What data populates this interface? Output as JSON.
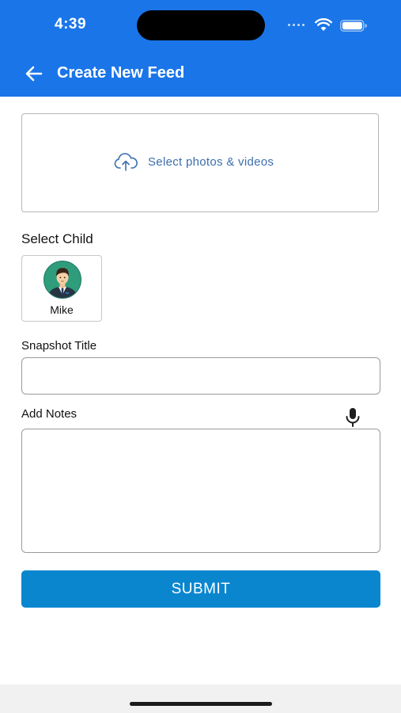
{
  "status_bar": {
    "time": "4:39"
  },
  "header": {
    "title": "Create New Feed",
    "background": "#1a75e8",
    "back_icon": "arrow-left-icon"
  },
  "upload": {
    "label": "Select photos & videos",
    "icon": "cloud-upload-icon"
  },
  "child_section": {
    "label": "Select Child",
    "children": [
      {
        "name": "Mike",
        "avatar": "boy-avatar-icon"
      }
    ]
  },
  "snapshot_title": {
    "label": "Snapshot Title",
    "value": "",
    "placeholder": ""
  },
  "notes": {
    "label": "Add Notes",
    "value": "",
    "placeholder": "",
    "mic_icon": "microphone-icon"
  },
  "submit": {
    "label": "SUBMIT",
    "background": "#0a86cf"
  }
}
